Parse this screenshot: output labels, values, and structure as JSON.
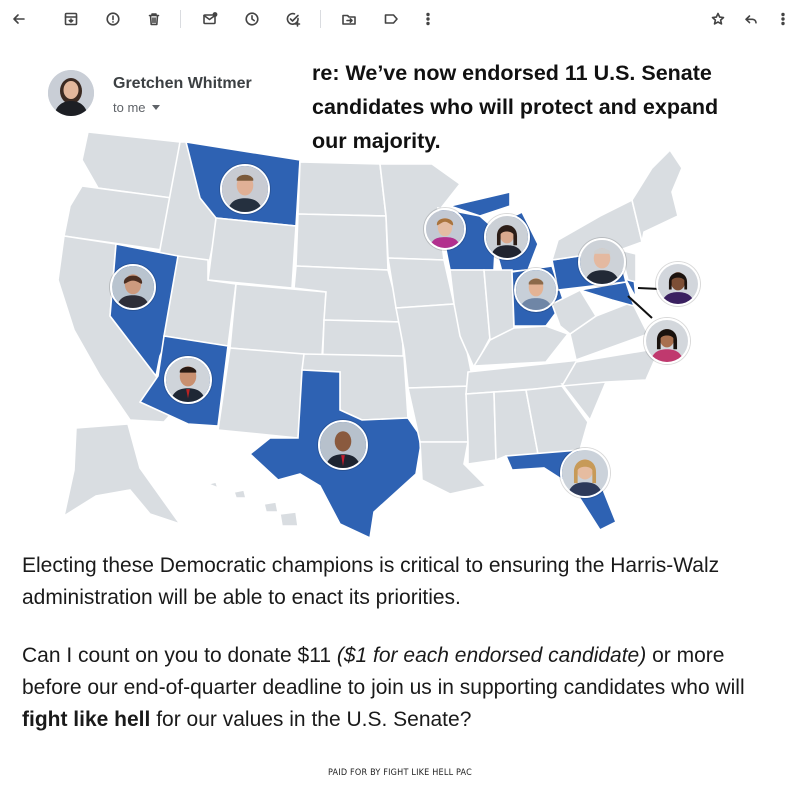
{
  "toolbar": {
    "icons": [
      "back-arrow-icon",
      "archive-icon",
      "report-spam-icon",
      "delete-icon",
      "mark-unread-icon",
      "snooze-icon",
      "add-task-icon",
      "move-to-icon",
      "label-icon",
      "more-vert-icon",
      "star-icon",
      "reply-icon",
      "more-vert-icon"
    ]
  },
  "sender": {
    "name": "Gretchen Whitmer",
    "to": "to me"
  },
  "headline": "re: We’ve now endorsed 11 U.S. Senate candidates who will protect and expand our majority.",
  "map": {
    "highlight_color": "#2e62b3",
    "base_color": "#d9dde1",
    "highlighted_states": [
      "Montana",
      "Nevada",
      "Arizona",
      "Texas",
      "Wisconsin",
      "Michigan",
      "Ohio",
      "Pennsylvania",
      "Maryland",
      "Delaware",
      "Florida"
    ]
  },
  "body": {
    "para1": "Electing these Democratic champions is critical to ensuring the Harris-Walz administration will be able to enact its priorities.",
    "para2_a": "Can I count on you to donate $11 ",
    "para2_em": "($1 for each endorsed candidate)",
    "para2_b": " or more before our end-of-quarter deadline to join us in supporting candidates who will ",
    "para2_strong": "fight like hell",
    "para2_c": " for our values in the U.S. Senate?"
  },
  "footer": "PAID FOR BY FIGHT LIKE HELL PAC"
}
